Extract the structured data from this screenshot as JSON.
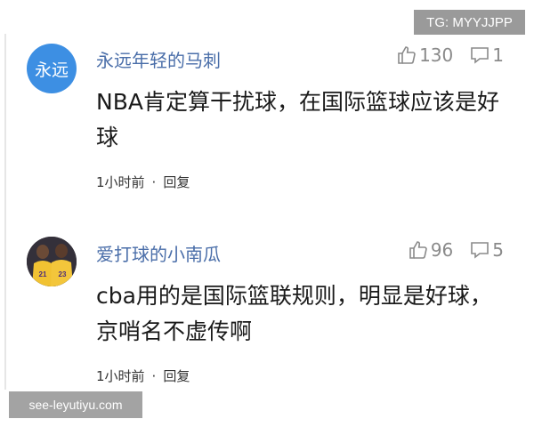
{
  "watermarks": {
    "top_right": "TG: MYYJJPP",
    "bottom_left": "see-leyutiyu.com"
  },
  "comments": [
    {
      "avatar_text": "永远",
      "avatar_color": "#3d8fe3",
      "username": "永远年轻的马刺",
      "likes": "130",
      "replies": "1",
      "text": "NBA肯定算干扰球，在国际篮球应该是好球",
      "time": "1小时前",
      "separator": "·",
      "reply_label": "回复"
    },
    {
      "avatar_text": "",
      "avatar_image": "photo of two basketball players in yellow jerseys",
      "jersey_numbers": [
        "21",
        "23"
      ],
      "username": "爱打球的小南瓜",
      "likes": "96",
      "replies": "5",
      "text": "cba用的是国际篮联规则，明显是好球，京哨名不虚传啊",
      "time": "1小时前",
      "separator": "·",
      "reply_label": "回复"
    }
  ],
  "icons": {
    "like": "thumbs-up-icon",
    "reply": "comment-bubble-icon"
  },
  "colors": {
    "username": "#4a6ea9",
    "meta_gray": "#8a8a8a",
    "watermark_bg": "#9a9a9a"
  }
}
